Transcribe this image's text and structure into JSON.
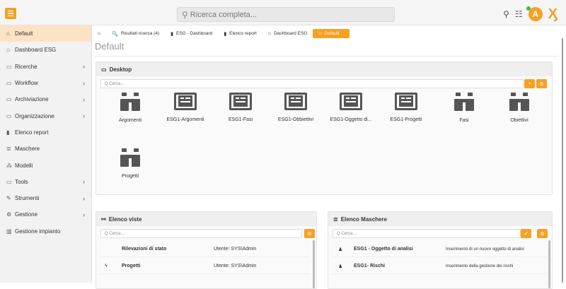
{
  "topbar": {
    "search_placeholder": "Ricerca completa...",
    "avatar_letter": "A",
    "icons": [
      "menu-icon",
      "search-icon",
      "palm-tree-icon",
      "chat-icon",
      "logo-x-icon"
    ]
  },
  "sidebar": {
    "items": [
      {
        "label": "Default",
        "icon": "home-icon",
        "glyph": "⌂",
        "chevron": false,
        "active": true
      },
      {
        "label": "Dashboard ESG",
        "icon": "home-icon",
        "glyph": "⌂",
        "chevron": false
      },
      {
        "label": "Ricerche",
        "icon": "folder-icon",
        "glyph": "▭",
        "chevron": true
      },
      {
        "label": "Workflow",
        "icon": "folder-icon",
        "glyph": "▭",
        "chevron": true
      },
      {
        "label": "Archiviazione",
        "icon": "folder-icon",
        "glyph": "▭",
        "chevron": true
      },
      {
        "label": "Organizzazione",
        "icon": "folder-icon",
        "glyph": "▭",
        "chevron": true
      },
      {
        "label": "Elenco report",
        "icon": "file-icon",
        "glyph": "▮",
        "chevron": false
      },
      {
        "label": "Maschere",
        "icon": "list-icon",
        "glyph": "≣",
        "chevron": false
      },
      {
        "label": "Modelli",
        "icon": "sitemap-icon",
        "glyph": "⁂",
        "chevron": false
      },
      {
        "label": "Tools",
        "icon": "folder-icon",
        "glyph": "▭",
        "chevron": true
      },
      {
        "label": "Strumenti",
        "icon": "wrench-icon",
        "glyph": "✎",
        "chevron": true
      },
      {
        "label": "Gestione",
        "icon": "cogs-icon",
        "glyph": "⚙",
        "chevron": true
      },
      {
        "label": "Gestione impianto",
        "icon": "bar-chart-icon",
        "glyph": "▥",
        "chevron": false
      }
    ]
  },
  "tabs": [
    {
      "label": "",
      "icon": "home-icon",
      "glyph": "⌂"
    },
    {
      "label": "Risultati ricerca (4)",
      "icon": "search-icon",
      "glyph": "🔍"
    },
    {
      "label": "ESG - Dashboard",
      "icon": "file-icon",
      "glyph": "▮"
    },
    {
      "label": "Elenco report",
      "icon": "file-icon",
      "glyph": "▮"
    },
    {
      "label": "Dashboard ESG",
      "icon": "home-icon",
      "glyph": "⌂"
    },
    {
      "label": "Default",
      "icon": "home-icon",
      "glyph": "⌂",
      "active": true
    }
  ],
  "page_title": "Default",
  "desktop": {
    "title": "Desktop",
    "search_placeholder": "Q Cerca...",
    "tiles": [
      {
        "label": "Argomenti",
        "icon": "binoculars-icon"
      },
      {
        "label": "ESG1-Argomenti",
        "icon": "newspaper-icon"
      },
      {
        "label": "ESG1-Fasi",
        "icon": "newspaper-icon"
      },
      {
        "label": "ESG1-Obbiettivi",
        "icon": "newspaper-icon"
      },
      {
        "label": "ESG1-Oggetto di...",
        "icon": "newspaper-icon"
      },
      {
        "label": "ESG1-Progetti",
        "icon": "newspaper-icon"
      },
      {
        "label": "Fasi",
        "icon": "binoculars-icon"
      },
      {
        "label": "Obiettivi",
        "icon": "binoculars-icon"
      },
      {
        "label": "Progetti",
        "icon": "binoculars-icon"
      }
    ]
  },
  "elenco_viste": {
    "title": "Elenco viste",
    "search_placeholder": "Q Cerca...",
    "rows": [
      {
        "icon": "",
        "name": "Rilevazioni di stato",
        "user": "Utente: SYS\\Admin"
      },
      {
        "icon": "bolt-icon",
        "name": "Progetti",
        "user": "Utente: SYS\\Admin"
      }
    ]
  },
  "elenco_maschere": {
    "title": "Elenco Maschere",
    "search_placeholder": "Q Cerca...",
    "rows": [
      {
        "icon": "user-icon",
        "name": "ESG1 - Oggetto di analisi",
        "desc": "Inserimento di un nuovo oggetto di analisi"
      },
      {
        "icon": "user-icon",
        "name": "ESG1- Rischi",
        "desc": "Inserimento della gestione dei rischi"
      }
    ]
  },
  "colors": {
    "accent": "#f7a023",
    "active_bg": "#fde2c5"
  }
}
